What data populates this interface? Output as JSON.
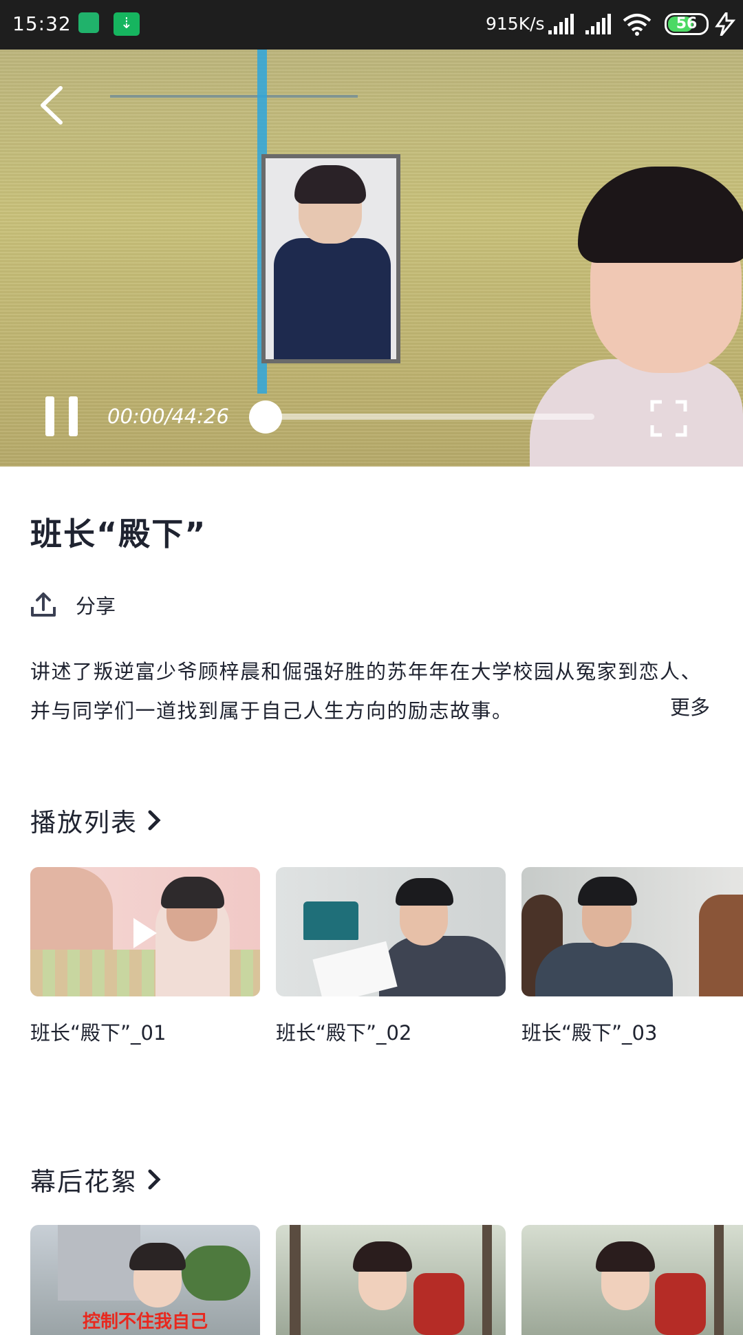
{
  "status_bar": {
    "time": "15:32",
    "download_icon": "⇣",
    "net_speed": "915K/s",
    "battery": "56"
  },
  "player": {
    "time_display": "00:00/44:26",
    "progress_percent": 0
  },
  "episode": {
    "title": "班长“殿下”",
    "share_label": "分享",
    "description": "讲述了叛逆富少爷顾梓晨和倔强好胜的苏年年在大学校园从冤家到恋人、并与同学们一道找到属于自己人生方向的励志故事。",
    "more_label": "更多"
  },
  "playlist": {
    "title": "播放列表",
    "items": [
      {
        "label": "班长“殿下”_01"
      },
      {
        "label": "班长“殿下”_02"
      },
      {
        "label": "班长“殿下”_03"
      }
    ]
  },
  "behind_scenes": {
    "title": "幕后花絮",
    "thumb_overlay_text": "控制不住我自己"
  },
  "colors": {
    "accent_blue": "#2fa6dc",
    "text_dark": "#1f2330",
    "status_bar": "#1e1e1e"
  }
}
